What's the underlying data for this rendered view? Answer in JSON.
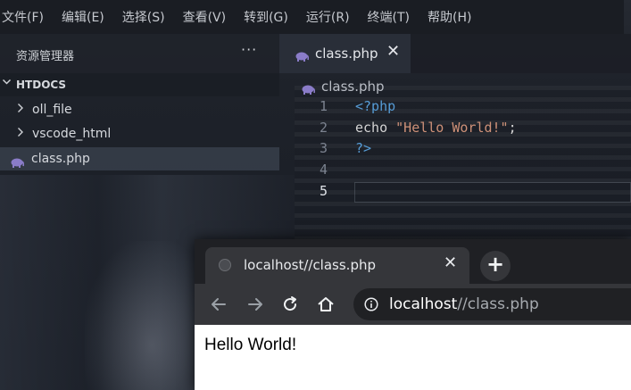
{
  "menubar": {
    "items": [
      "文件(F)",
      "编辑(E)",
      "选择(S)",
      "查看(V)",
      "转到(G)",
      "运行(R)",
      "终端(T)",
      "帮助(H)"
    ]
  },
  "sidebar": {
    "title": "资源管理器",
    "more_label": "···",
    "folder": {
      "name": "HTDOCS",
      "expanded": true
    },
    "items": [
      {
        "label": "oll_file",
        "type": "folder",
        "icon": "chevron-right-icon"
      },
      {
        "label": "vscode_html",
        "type": "folder",
        "icon": "chevron-right-icon"
      },
      {
        "label": "class.php",
        "type": "file",
        "icon": "php-elephant-icon",
        "selected": true
      }
    ]
  },
  "editor": {
    "tab": {
      "label": "class.php",
      "icon": "php-elephant-icon",
      "close_label": "✕"
    },
    "breadcrumb": "class.php",
    "lines": [
      {
        "number": "1",
        "tokens": [
          {
            "text": "<?php",
            "kind": "tag"
          }
        ]
      },
      {
        "number": "2",
        "tokens": [
          {
            "text": "echo ",
            "kind": "kw"
          },
          {
            "text": "\"Hello World!\"",
            "kind": "str"
          },
          {
            "text": ";",
            "kind": "plain"
          }
        ]
      },
      {
        "number": "3",
        "tokens": [
          {
            "text": "?>",
            "kind": "tag"
          }
        ]
      },
      {
        "number": "4",
        "tokens": []
      },
      {
        "number": "5",
        "tokens": [],
        "active": true
      }
    ]
  },
  "browser": {
    "tab": {
      "title": "localhost//class.php",
      "close_label": "✕"
    },
    "new_tab_label": "+",
    "address": {
      "host": "localhost",
      "path": "//class.php"
    },
    "page": {
      "text": "Hello World!"
    }
  },
  "colors": {
    "php_icon": "#8a7cc8",
    "keyword_tag": "#569cd6",
    "string": "#ce9178",
    "browser_chrome": "#35363a",
    "omnibox": "#202124"
  }
}
